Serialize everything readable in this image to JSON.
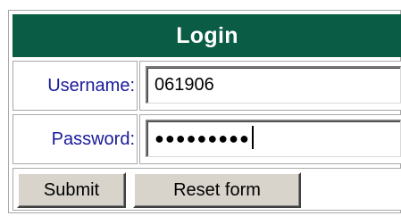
{
  "login_form": {
    "title": "Login",
    "username": {
      "label": "Username:",
      "value": "061906"
    },
    "password": {
      "label": "Password:",
      "masked_value": "●●●●●●●●●",
      "character_count": 9
    },
    "buttons": {
      "submit_label": "Submit",
      "reset_label": "Reset form"
    }
  },
  "colors": {
    "header_background": "#0b5c44",
    "header_text": "#ffffff",
    "label_text": "#1a1a9c",
    "button_face": "#d8d4cc"
  }
}
